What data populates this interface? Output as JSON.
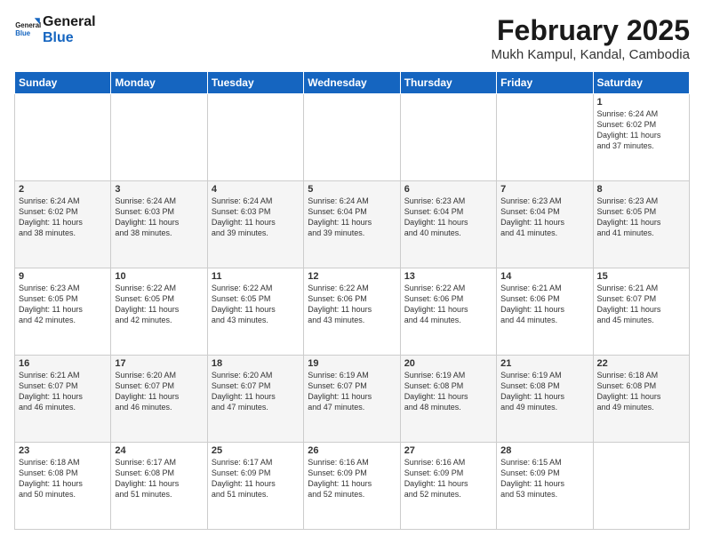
{
  "header": {
    "logo_line1": "General",
    "logo_line2": "Blue",
    "month_title": "February 2025",
    "location": "Mukh Kampul, Kandal, Cambodia"
  },
  "days_of_week": [
    "Sunday",
    "Monday",
    "Tuesday",
    "Wednesday",
    "Thursday",
    "Friday",
    "Saturday"
  ],
  "weeks": [
    [
      {
        "day": "",
        "info": ""
      },
      {
        "day": "",
        "info": ""
      },
      {
        "day": "",
        "info": ""
      },
      {
        "day": "",
        "info": ""
      },
      {
        "day": "",
        "info": ""
      },
      {
        "day": "",
        "info": ""
      },
      {
        "day": "1",
        "info": "Sunrise: 6:24 AM\nSunset: 6:02 PM\nDaylight: 11 hours\nand 37 minutes."
      }
    ],
    [
      {
        "day": "2",
        "info": "Sunrise: 6:24 AM\nSunset: 6:02 PM\nDaylight: 11 hours\nand 38 minutes."
      },
      {
        "day": "3",
        "info": "Sunrise: 6:24 AM\nSunset: 6:03 PM\nDaylight: 11 hours\nand 38 minutes."
      },
      {
        "day": "4",
        "info": "Sunrise: 6:24 AM\nSunset: 6:03 PM\nDaylight: 11 hours\nand 39 minutes."
      },
      {
        "day": "5",
        "info": "Sunrise: 6:24 AM\nSunset: 6:04 PM\nDaylight: 11 hours\nand 39 minutes."
      },
      {
        "day": "6",
        "info": "Sunrise: 6:23 AM\nSunset: 6:04 PM\nDaylight: 11 hours\nand 40 minutes."
      },
      {
        "day": "7",
        "info": "Sunrise: 6:23 AM\nSunset: 6:04 PM\nDaylight: 11 hours\nand 41 minutes."
      },
      {
        "day": "8",
        "info": "Sunrise: 6:23 AM\nSunset: 6:05 PM\nDaylight: 11 hours\nand 41 minutes."
      }
    ],
    [
      {
        "day": "9",
        "info": "Sunrise: 6:23 AM\nSunset: 6:05 PM\nDaylight: 11 hours\nand 42 minutes."
      },
      {
        "day": "10",
        "info": "Sunrise: 6:22 AM\nSunset: 6:05 PM\nDaylight: 11 hours\nand 42 minutes."
      },
      {
        "day": "11",
        "info": "Sunrise: 6:22 AM\nSunset: 6:05 PM\nDaylight: 11 hours\nand 43 minutes."
      },
      {
        "day": "12",
        "info": "Sunrise: 6:22 AM\nSunset: 6:06 PM\nDaylight: 11 hours\nand 43 minutes."
      },
      {
        "day": "13",
        "info": "Sunrise: 6:22 AM\nSunset: 6:06 PM\nDaylight: 11 hours\nand 44 minutes."
      },
      {
        "day": "14",
        "info": "Sunrise: 6:21 AM\nSunset: 6:06 PM\nDaylight: 11 hours\nand 44 minutes."
      },
      {
        "day": "15",
        "info": "Sunrise: 6:21 AM\nSunset: 6:07 PM\nDaylight: 11 hours\nand 45 minutes."
      }
    ],
    [
      {
        "day": "16",
        "info": "Sunrise: 6:21 AM\nSunset: 6:07 PM\nDaylight: 11 hours\nand 46 minutes."
      },
      {
        "day": "17",
        "info": "Sunrise: 6:20 AM\nSunset: 6:07 PM\nDaylight: 11 hours\nand 46 minutes."
      },
      {
        "day": "18",
        "info": "Sunrise: 6:20 AM\nSunset: 6:07 PM\nDaylight: 11 hours\nand 47 minutes."
      },
      {
        "day": "19",
        "info": "Sunrise: 6:19 AM\nSunset: 6:07 PM\nDaylight: 11 hours\nand 47 minutes."
      },
      {
        "day": "20",
        "info": "Sunrise: 6:19 AM\nSunset: 6:08 PM\nDaylight: 11 hours\nand 48 minutes."
      },
      {
        "day": "21",
        "info": "Sunrise: 6:19 AM\nSunset: 6:08 PM\nDaylight: 11 hours\nand 49 minutes."
      },
      {
        "day": "22",
        "info": "Sunrise: 6:18 AM\nSunset: 6:08 PM\nDaylight: 11 hours\nand 49 minutes."
      }
    ],
    [
      {
        "day": "23",
        "info": "Sunrise: 6:18 AM\nSunset: 6:08 PM\nDaylight: 11 hours\nand 50 minutes."
      },
      {
        "day": "24",
        "info": "Sunrise: 6:17 AM\nSunset: 6:08 PM\nDaylight: 11 hours\nand 51 minutes."
      },
      {
        "day": "25",
        "info": "Sunrise: 6:17 AM\nSunset: 6:09 PM\nDaylight: 11 hours\nand 51 minutes."
      },
      {
        "day": "26",
        "info": "Sunrise: 6:16 AM\nSunset: 6:09 PM\nDaylight: 11 hours\nand 52 minutes."
      },
      {
        "day": "27",
        "info": "Sunrise: 6:16 AM\nSunset: 6:09 PM\nDaylight: 11 hours\nand 52 minutes."
      },
      {
        "day": "28",
        "info": "Sunrise: 6:15 AM\nSunset: 6:09 PM\nDaylight: 11 hours\nand 53 minutes."
      },
      {
        "day": "",
        "info": ""
      }
    ]
  ]
}
